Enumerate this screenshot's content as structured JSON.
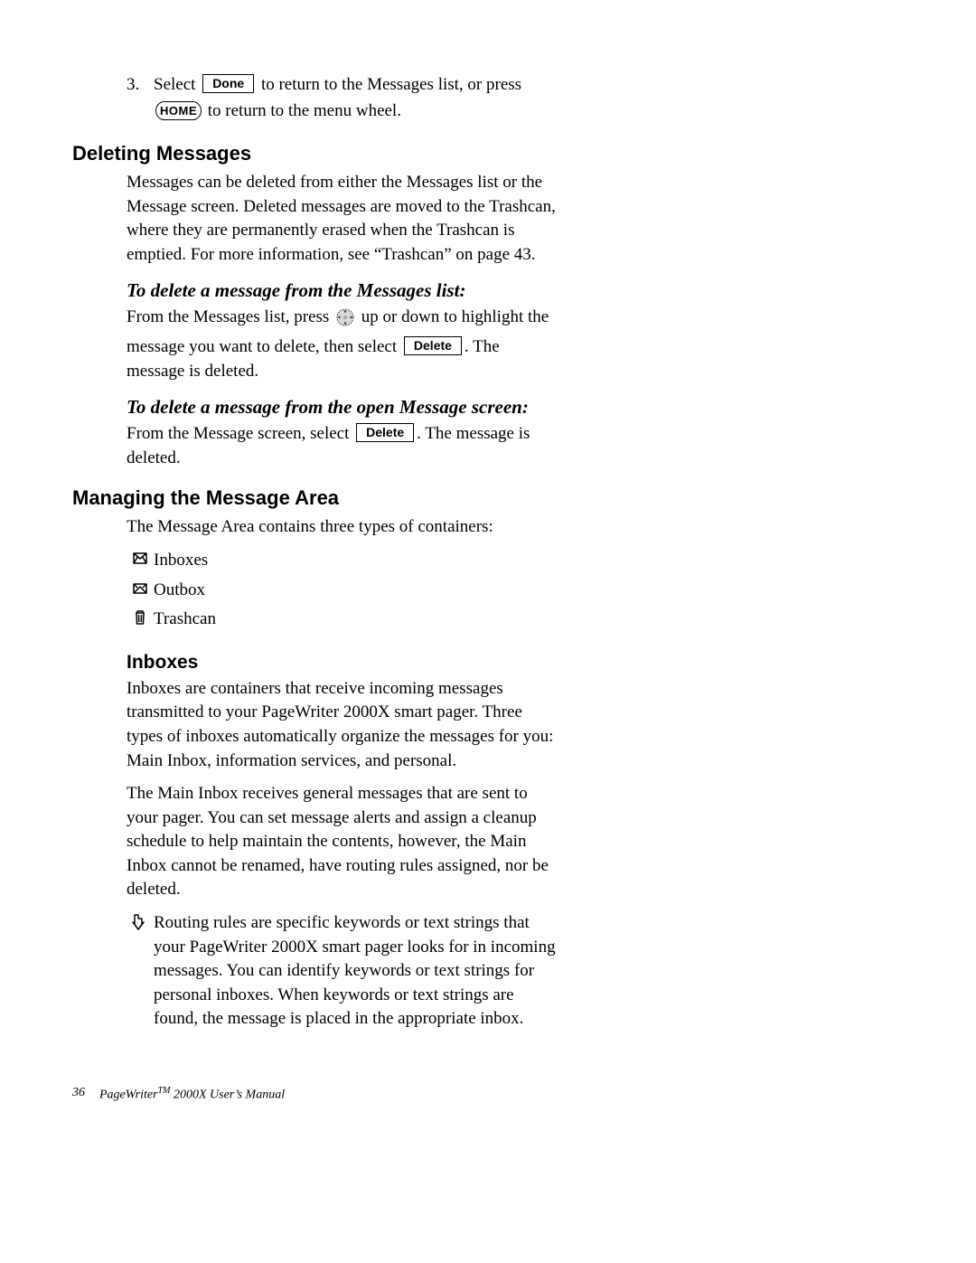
{
  "step3": {
    "num": "3.",
    "text_a": "Select ",
    "btn_done": "Done",
    "text_b": " to return to the Messages list, or press ",
    "btn_home": "HOME",
    "text_c": " to return to the menu wheel."
  },
  "deleting": {
    "heading": "Deleting Messages",
    "para": "Messages can be deleted from either the Messages list or the Message screen. Deleted messages are moved to the Trashcan, where they are permanently erased when the Trashcan is emptied. For more information, see “Trashcan” on page 43."
  },
  "del_list": {
    "heading": "To delete a message from the Messages list:",
    "text_a": "From the Messages list, press ",
    "text_b": " up or down to highlight the message you want to delete, then select ",
    "btn": "Delete",
    "text_c": ". The message is deleted."
  },
  "del_screen": {
    "heading": "To delete a message from the open Message screen:",
    "text_a": "From the Message screen, select ",
    "btn": "Delete",
    "text_b": ". The message is deleted."
  },
  "managing": {
    "heading": "Managing the Message Area",
    "intro": "The Message Area contains three types of containers:",
    "items": {
      "inboxes": "Inboxes",
      "outbox": "Outbox",
      "trashcan": "Trashcan"
    }
  },
  "inboxes": {
    "heading": "Inboxes",
    "para1": "Inboxes are containers that receive incoming messages transmitted to your PageWriter 2000X smart pager. Three types of inboxes automatically organize the messages for you: Main Inbox, information services, and personal.",
    "para2": "The Main Inbox receives general messages that are sent to your pager. You can set message alerts and assign a cleanup schedule to help maintain the contents, however, the Main Inbox cannot be renamed, have routing rules assigned, nor be deleted.",
    "note": "Routing rules are specific keywords or text strings that your PageWriter 2000X smart pager looks for in incoming messages. You can identify keywords or text strings for personal inboxes. When keywords or text strings are found, the message is placed in the appropriate inbox."
  },
  "footer": {
    "page_num": "36",
    "title_a": "PageWriter",
    "tm": "TM",
    "title_b": " 2000X User’s Manual"
  }
}
